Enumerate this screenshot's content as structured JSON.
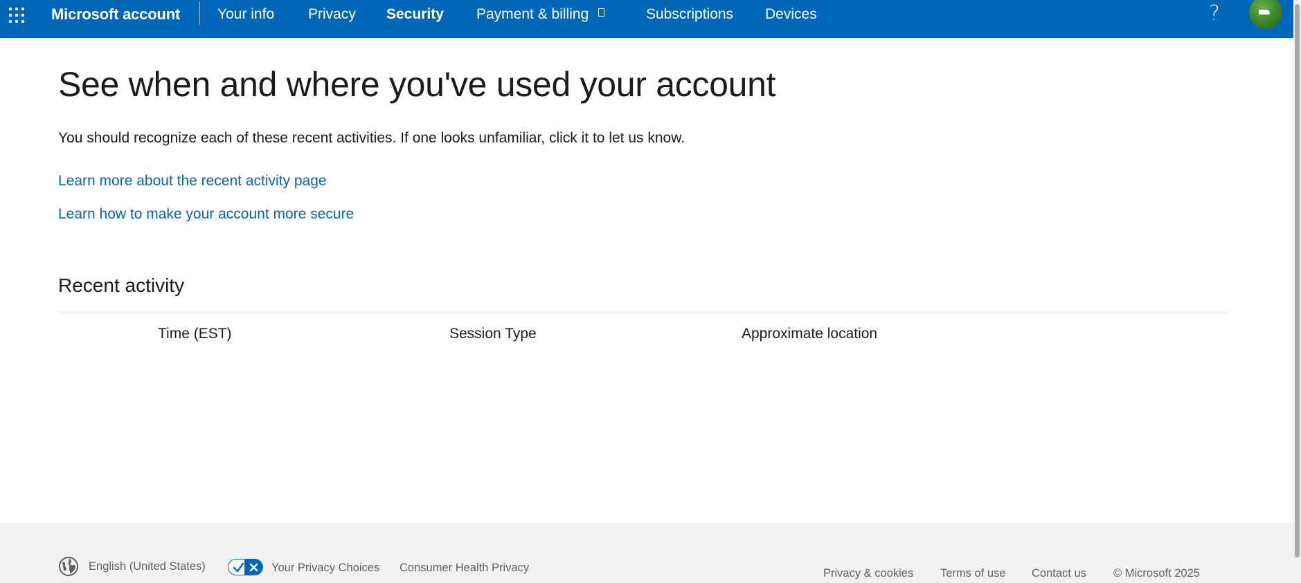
{
  "header": {
    "brand": "Microsoft account",
    "nav": [
      {
        "label": "Your info"
      },
      {
        "label": "Privacy"
      },
      {
        "label": "Security",
        "active": true
      },
      {
        "label": "Payment & billing",
        "icon": "external-link-icon"
      },
      {
        "label": "Subscriptions"
      },
      {
        "label": "Devices"
      }
    ],
    "help_glyph": "?",
    "accent_color": "#0067b8"
  },
  "main": {
    "title": "See when and where you've used your account",
    "intro": "You should recognize each of these recent activities. If one looks unfamiliar, click it to let us know.",
    "links": [
      {
        "label": "Learn more about the recent activity page"
      },
      {
        "label": "Learn how to make your account more secure"
      }
    ],
    "section_title": "Recent activity",
    "columns": [
      "Time (EST)",
      "Session Type",
      "Approximate location"
    ],
    "rows": []
  },
  "footer": {
    "language": "English (United States)",
    "privacy_choices": "Your Privacy Choices",
    "health_privacy": "Consumer Health Privacy",
    "links": [
      "Privacy & cookies",
      "Terms of use",
      "Contact us"
    ],
    "copyright": "© Microsoft 2025"
  }
}
